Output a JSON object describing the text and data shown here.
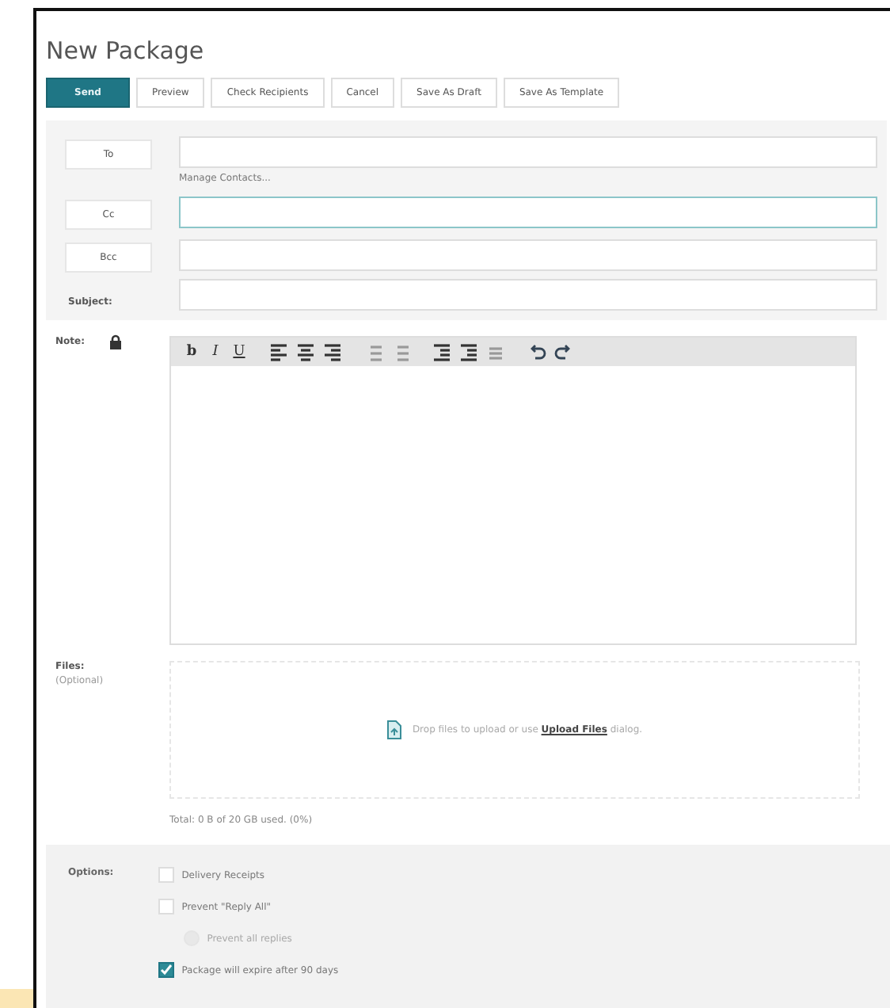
{
  "title": "New Package",
  "actions": [
    {
      "label": "Send",
      "kind": "primary"
    },
    {
      "label": "Preview",
      "kind": "plain"
    },
    {
      "label": "Check Recipients",
      "kind": "plain"
    },
    {
      "label": "Cancel",
      "kind": "plain"
    },
    {
      "label": "Save As Draft",
      "kind": "plain"
    },
    {
      "label": "Save As Template",
      "kind": "plain"
    }
  ],
  "recipients": [
    {
      "label": "To",
      "kind": "button",
      "focused": false,
      "link": "Manage Contacts..."
    },
    {
      "label": "Cc",
      "kind": "button",
      "focused": true
    },
    {
      "label": "Bcc",
      "kind": "button",
      "focused": false
    },
    {
      "label": "Subject:",
      "kind": "label",
      "focused": false
    }
  ],
  "note": {
    "label": "Note:",
    "toolbar": [
      {
        "kind": "bold",
        "text": "b"
      },
      {
        "kind": "italic",
        "text": "I"
      },
      {
        "kind": "underline",
        "text": "U"
      },
      {
        "kind": "sep"
      },
      {
        "kind": "align-left"
      },
      {
        "kind": "align-center"
      },
      {
        "kind": "align-right"
      },
      {
        "kind": "sep"
      },
      {
        "kind": "bullet-list"
      },
      {
        "kind": "number-list"
      },
      {
        "kind": "sep"
      },
      {
        "kind": "outdent"
      },
      {
        "kind": "indent"
      },
      {
        "kind": "quote"
      },
      {
        "kind": "sep"
      },
      {
        "kind": "undo"
      },
      {
        "kind": "redo"
      }
    ]
  },
  "files": {
    "label": "Files:",
    "hint": "(Optional)",
    "drop_before": "Drop files to upload or use",
    "drop_link": "Upload Files",
    "drop_after": "dialog.",
    "usage": "Total: 0 B of 20 GB used. (0%)"
  },
  "options": {
    "label": "Options:",
    "items": [
      {
        "label": "Delivery Receipts",
        "checked": false,
        "disabled": false,
        "nested": false
      },
      {
        "label": "Prevent \"Reply All\"",
        "checked": false,
        "disabled": false,
        "nested": false
      },
      {
        "label": "Prevent all replies",
        "checked": false,
        "disabled": true,
        "nested": true
      },
      {
        "label": "Package will expire after 90 days",
        "checked": true,
        "disabled": false,
        "nested": false
      }
    ]
  }
}
